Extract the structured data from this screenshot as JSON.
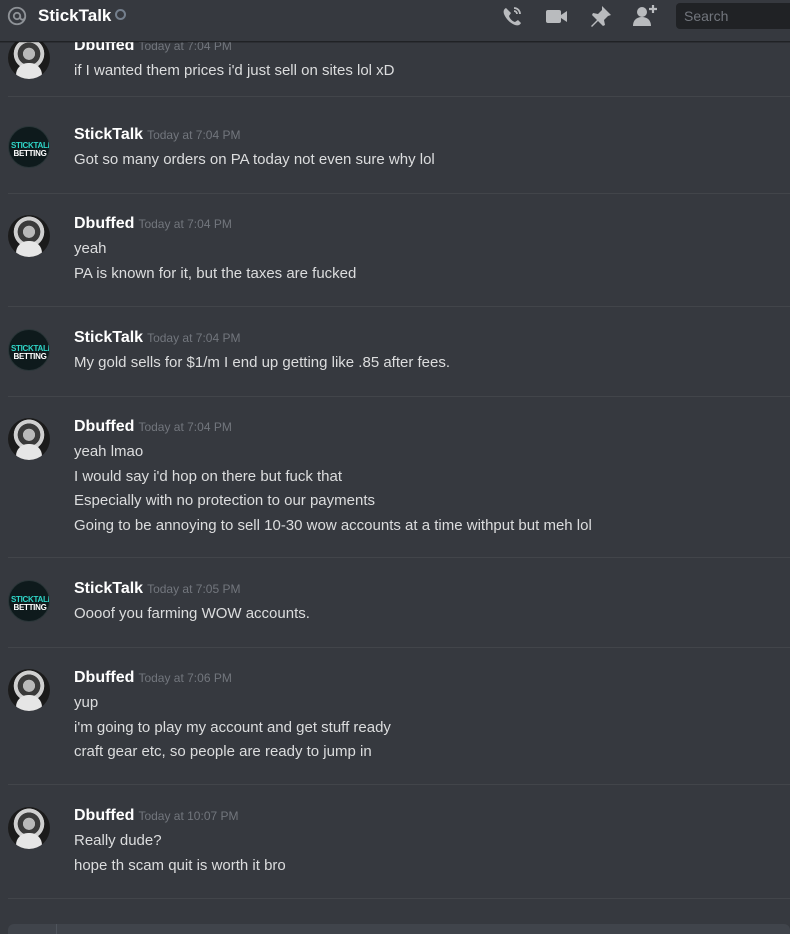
{
  "header": {
    "channel_name": "StickTalk",
    "search_placeholder": "Search",
    "icons": [
      "at-icon",
      "phone-call-icon",
      "video-call-icon",
      "pin-icon",
      "add-friend-icon"
    ]
  },
  "messages": [
    {
      "author": "Dbuffed",
      "timestamp": "Today at 7:04 PM",
      "lines": [
        "if I wanted them prices i'd just sell on sites lol xD"
      ]
    },
    {
      "author": "StickTalk",
      "timestamp": "Today at 7:04 PM",
      "lines": [
        "Got so many orders on PA today not even sure why lol"
      ]
    },
    {
      "author": "Dbuffed",
      "timestamp": "Today at 7:04 PM",
      "lines": [
        "yeah",
        "PA is known for it, but the taxes are fucked"
      ]
    },
    {
      "author": "StickTalk",
      "timestamp": "Today at 7:04 PM",
      "lines": [
        "My gold sells for $1/m I end up getting like .85 after fees."
      ]
    },
    {
      "author": "Dbuffed",
      "timestamp": "Today at 7:04 PM",
      "lines": [
        "yeah lmao",
        "I would say i'd hop on there but fuck that",
        "Especially with no protection to our payments",
        "Going to be annoying to sell 10-30 wow accounts at a time withput but meh lol"
      ]
    },
    {
      "author": "StickTalk",
      "timestamp": "Today at 7:05 PM",
      "lines": [
        "Oooof you farming WOW accounts."
      ]
    },
    {
      "author": "Dbuffed",
      "timestamp": "Today at 7:06 PM",
      "lines": [
        "yup",
        "i'm going to play my account and get stuff ready",
        "craft gear etc, so people are ready to jump in"
      ]
    },
    {
      "author": "Dbuffed",
      "timestamp": "Today at 10:07 PM",
      "lines": [
        "Really dude?",
        "hope th scam quit is worth it bro"
      ]
    }
  ],
  "avatar_text": {
    "line1": "STICKTALK",
    "line2": "BETTING"
  }
}
